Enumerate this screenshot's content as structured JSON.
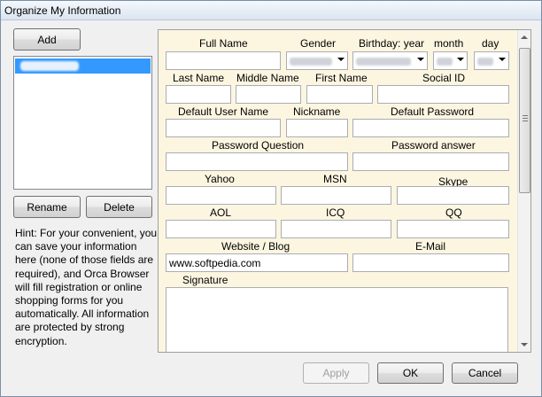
{
  "window": {
    "title": "Organize My Information"
  },
  "left": {
    "add_label": "Add",
    "rename_label": "Rename",
    "delete_label": "Delete",
    "hint": "Hint: For your convenient, you can save your information here (none of those fields are required), and Orca Browser will fill registration or online shopping forms for you automatically. All information are protected by strong encryption."
  },
  "form": {
    "full_name": {
      "label": "Full Name",
      "value": ""
    },
    "gender": {
      "label": "Gender"
    },
    "birthday_year": {
      "label": "Birthday: year"
    },
    "month": {
      "label": "month"
    },
    "day": {
      "label": "day"
    },
    "last_name": {
      "label": "Last Name",
      "value": ""
    },
    "middle_name": {
      "label": "Middle Name",
      "value": ""
    },
    "first_name": {
      "label": "First Name",
      "value": ""
    },
    "social_id": {
      "label": "Social ID",
      "value": ""
    },
    "default_user_name": {
      "label": "Default User Name",
      "value": ""
    },
    "nickname": {
      "label": "Nickname",
      "value": ""
    },
    "default_password": {
      "label": "Default Password",
      "value": ""
    },
    "password_question": {
      "label": "Password Question",
      "value": ""
    },
    "password_answer": {
      "label": "Password answer",
      "value": ""
    },
    "yahoo": {
      "label": "Yahoo",
      "value": ""
    },
    "msn": {
      "label": "MSN",
      "value": ""
    },
    "skype": {
      "label": "Skype",
      "value": ""
    },
    "aol": {
      "label": "AOL",
      "value": ""
    },
    "icq": {
      "label": "ICQ",
      "value": ""
    },
    "qq": {
      "label": "QQ",
      "value": ""
    },
    "website": {
      "label": "Website / Blog",
      "value": "www.softpedia.com"
    },
    "email": {
      "label": "E-Mail",
      "value": ""
    },
    "signature": {
      "label": "Signature"
    }
  },
  "footer": {
    "apply_label": "Apply",
    "ok_label": "OK",
    "cancel_label": "Cancel"
  },
  "icons": {
    "dropdown": "chevron-down-icon",
    "scroll_up": "arrow-up-icon",
    "scroll_down": "arrow-down-icon"
  },
  "colors": {
    "panel_bg": "#fcf6e1",
    "selection": "#3399ff"
  }
}
